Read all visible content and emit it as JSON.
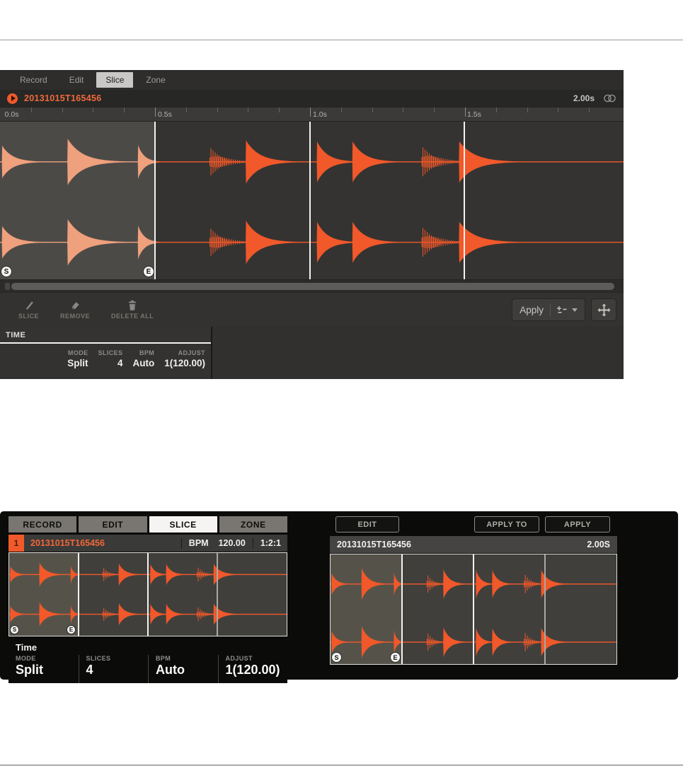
{
  "software_panel": {
    "tabs": [
      {
        "label": "Record",
        "active": false
      },
      {
        "label": "Edit",
        "active": false
      },
      {
        "label": "Slice",
        "active": true
      },
      {
        "label": "Zone",
        "active": false
      }
    ],
    "title_bar": {
      "sample_name": "20131015T165456",
      "duration": "2.00s"
    },
    "ruler": {
      "labels": [
        {
          "text": "0.0s",
          "pos": 0.003
        },
        {
          "text": "0.5s",
          "pos": 0.2486
        },
        {
          "text": "1.0s",
          "pos": 0.4972
        },
        {
          "text": "1.5s",
          "pos": 0.7446
        }
      ]
    },
    "toolbar": {
      "slice_label": "SLICE",
      "remove_label": "REMOVE",
      "delete_all_label": "DELETE ALL",
      "apply_label": "Apply"
    },
    "time_section": {
      "header": "TIME",
      "params": [
        {
          "label": "MODE",
          "value": "Split"
        },
        {
          "label": "SLICES",
          "value": "4"
        },
        {
          "label": "BPM",
          "value": "Auto"
        },
        {
          "label": "ADJUST",
          "value": "1(120.00)"
        }
      ]
    }
  },
  "hardware_left": {
    "tabs": [
      {
        "label": "RECORD",
        "active": false
      },
      {
        "label": "EDIT",
        "active": false
      },
      {
        "label": "SLICE",
        "active": true
      },
      {
        "label": "ZONE",
        "active": false
      }
    ],
    "info_bar": {
      "pad_number": "1",
      "sample_name": "20131015T165456",
      "bpm_label": "BPM",
      "bpm_value": "120.00",
      "position": "1:2:1"
    },
    "footer": {
      "header": "Time",
      "params": [
        {
          "label": "MODE",
          "value": "Split"
        },
        {
          "label": "SLICES",
          "value": "4"
        },
        {
          "label": "BPM",
          "value": "Auto"
        },
        {
          "label": "ADJUST",
          "value": "1(120.00)"
        }
      ]
    }
  },
  "hardware_right": {
    "buttons": {
      "edit": "EDIT",
      "apply_to": "APPLY TO",
      "apply": "APPLY"
    },
    "info_bar": {
      "sample_name": "20131015T165456",
      "duration": "2.00S"
    }
  },
  "waveform": {
    "color": "#f1582a",
    "markers": {
      "start": "S",
      "end": "E"
    },
    "bursts": [
      {
        "pos": 0.003,
        "amp": 0.62,
        "len": 0.075,
        "type": "smooth"
      },
      {
        "pos": 0.108,
        "amp": 0.88,
        "len": 0.105,
        "type": "smooth"
      },
      {
        "pos": 0.221,
        "amp": 0.65,
        "len": 0.045,
        "type": "smooth"
      },
      {
        "pos": 0.336,
        "amp": 0.55,
        "len": 0.06,
        "type": "dense"
      },
      {
        "pos": 0.394,
        "amp": 0.82,
        "len": 0.095,
        "type": "smooth"
      },
      {
        "pos": 0.508,
        "amp": 0.78,
        "len": 0.075,
        "type": "smooth"
      },
      {
        "pos": 0.565,
        "amp": 0.78,
        "len": 0.085,
        "type": "smooth"
      },
      {
        "pos": 0.676,
        "amp": 0.58,
        "len": 0.065,
        "type": "dense"
      },
      {
        "pos": 0.736,
        "amp": 0.78,
        "len": 0.11,
        "type": "smooth"
      }
    ],
    "views": {
      "panel": {
        "sel_end": 0.2486,
        "ch1": 0.255,
        "ch2": 0.765,
        "amp": 0.17,
        "sel_wave_color": "#efa07d",
        "lines": [
          {
            "pos": 0.2486,
            "color": "#f2f2f0"
          },
          {
            "pos": 0.4972,
            "color": "#f2f2f0"
          },
          {
            "pos": 0.7446,
            "color": "#f2f2f0"
          }
        ]
      },
      "hwl": {
        "sel_end": 0.25,
        "ch1": 0.26,
        "ch2": 0.74,
        "amp": 0.17,
        "sel_wave_color": "#f1582a",
        "lines": [
          {
            "pos": 0.25,
            "color": "#f2f2f0"
          },
          {
            "pos": 0.5,
            "color": "#f2f2f0"
          },
          {
            "pos": 0.75,
            "color": "#a8a8a4"
          }
        ]
      },
      "hwr": {
        "sel_end": 0.25,
        "ch1": 0.27,
        "ch2": 0.8,
        "amp": 0.17,
        "sel_wave_color": "#f1582a",
        "lines": [
          {
            "pos": 0.25,
            "color": "#f2f2f0"
          },
          {
            "pos": 0.5,
            "color": "#f2f2f0"
          },
          {
            "pos": 0.75,
            "color": "#a8a8a4"
          }
        ]
      }
    }
  }
}
